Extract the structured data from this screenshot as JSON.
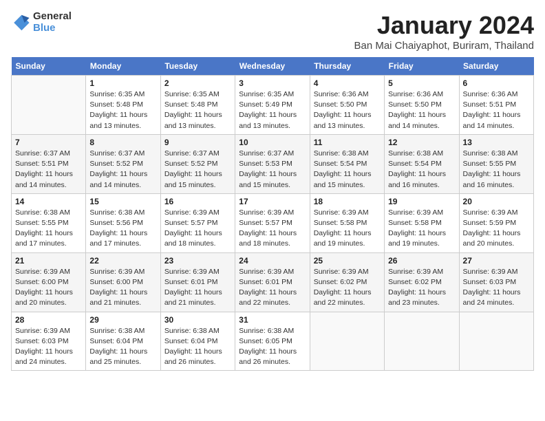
{
  "logo": {
    "general": "General",
    "blue": "Blue"
  },
  "title": {
    "month": "January 2024",
    "location": "Ban Mai Chaiyaphot, Buriram, Thailand"
  },
  "weekdays": [
    "Sunday",
    "Monday",
    "Tuesday",
    "Wednesday",
    "Thursday",
    "Friday",
    "Saturday"
  ],
  "weeks": [
    [
      {
        "day": "",
        "info": ""
      },
      {
        "day": "1",
        "info": "Sunrise: 6:35 AM\nSunset: 5:48 PM\nDaylight: 11 hours\nand 13 minutes."
      },
      {
        "day": "2",
        "info": "Sunrise: 6:35 AM\nSunset: 5:48 PM\nDaylight: 11 hours\nand 13 minutes."
      },
      {
        "day": "3",
        "info": "Sunrise: 6:35 AM\nSunset: 5:49 PM\nDaylight: 11 hours\nand 13 minutes."
      },
      {
        "day": "4",
        "info": "Sunrise: 6:36 AM\nSunset: 5:50 PM\nDaylight: 11 hours\nand 13 minutes."
      },
      {
        "day": "5",
        "info": "Sunrise: 6:36 AM\nSunset: 5:50 PM\nDaylight: 11 hours\nand 14 minutes."
      },
      {
        "day": "6",
        "info": "Sunrise: 6:36 AM\nSunset: 5:51 PM\nDaylight: 11 hours\nand 14 minutes."
      }
    ],
    [
      {
        "day": "7",
        "info": "Sunrise: 6:37 AM\nSunset: 5:51 PM\nDaylight: 11 hours\nand 14 minutes."
      },
      {
        "day": "8",
        "info": "Sunrise: 6:37 AM\nSunset: 5:52 PM\nDaylight: 11 hours\nand 14 minutes."
      },
      {
        "day": "9",
        "info": "Sunrise: 6:37 AM\nSunset: 5:52 PM\nDaylight: 11 hours\nand 15 minutes."
      },
      {
        "day": "10",
        "info": "Sunrise: 6:37 AM\nSunset: 5:53 PM\nDaylight: 11 hours\nand 15 minutes."
      },
      {
        "day": "11",
        "info": "Sunrise: 6:38 AM\nSunset: 5:54 PM\nDaylight: 11 hours\nand 15 minutes."
      },
      {
        "day": "12",
        "info": "Sunrise: 6:38 AM\nSunset: 5:54 PM\nDaylight: 11 hours\nand 16 minutes."
      },
      {
        "day": "13",
        "info": "Sunrise: 6:38 AM\nSunset: 5:55 PM\nDaylight: 11 hours\nand 16 minutes."
      }
    ],
    [
      {
        "day": "14",
        "info": "Sunrise: 6:38 AM\nSunset: 5:55 PM\nDaylight: 11 hours\nand 17 minutes."
      },
      {
        "day": "15",
        "info": "Sunrise: 6:38 AM\nSunset: 5:56 PM\nDaylight: 11 hours\nand 17 minutes."
      },
      {
        "day": "16",
        "info": "Sunrise: 6:39 AM\nSunset: 5:57 PM\nDaylight: 11 hours\nand 18 minutes."
      },
      {
        "day": "17",
        "info": "Sunrise: 6:39 AM\nSunset: 5:57 PM\nDaylight: 11 hours\nand 18 minutes."
      },
      {
        "day": "18",
        "info": "Sunrise: 6:39 AM\nSunset: 5:58 PM\nDaylight: 11 hours\nand 19 minutes."
      },
      {
        "day": "19",
        "info": "Sunrise: 6:39 AM\nSunset: 5:58 PM\nDaylight: 11 hours\nand 19 minutes."
      },
      {
        "day": "20",
        "info": "Sunrise: 6:39 AM\nSunset: 5:59 PM\nDaylight: 11 hours\nand 20 minutes."
      }
    ],
    [
      {
        "day": "21",
        "info": "Sunrise: 6:39 AM\nSunset: 6:00 PM\nDaylight: 11 hours\nand 20 minutes."
      },
      {
        "day": "22",
        "info": "Sunrise: 6:39 AM\nSunset: 6:00 PM\nDaylight: 11 hours\nand 21 minutes."
      },
      {
        "day": "23",
        "info": "Sunrise: 6:39 AM\nSunset: 6:01 PM\nDaylight: 11 hours\nand 21 minutes."
      },
      {
        "day": "24",
        "info": "Sunrise: 6:39 AM\nSunset: 6:01 PM\nDaylight: 11 hours\nand 22 minutes."
      },
      {
        "day": "25",
        "info": "Sunrise: 6:39 AM\nSunset: 6:02 PM\nDaylight: 11 hours\nand 22 minutes."
      },
      {
        "day": "26",
        "info": "Sunrise: 6:39 AM\nSunset: 6:02 PM\nDaylight: 11 hours\nand 23 minutes."
      },
      {
        "day": "27",
        "info": "Sunrise: 6:39 AM\nSunset: 6:03 PM\nDaylight: 11 hours\nand 24 minutes."
      }
    ],
    [
      {
        "day": "28",
        "info": "Sunrise: 6:39 AM\nSunset: 6:03 PM\nDaylight: 11 hours\nand 24 minutes."
      },
      {
        "day": "29",
        "info": "Sunrise: 6:38 AM\nSunset: 6:04 PM\nDaylight: 11 hours\nand 25 minutes."
      },
      {
        "day": "30",
        "info": "Sunrise: 6:38 AM\nSunset: 6:04 PM\nDaylight: 11 hours\nand 26 minutes."
      },
      {
        "day": "31",
        "info": "Sunrise: 6:38 AM\nSunset: 6:05 PM\nDaylight: 11 hours\nand 26 minutes."
      },
      {
        "day": "",
        "info": ""
      },
      {
        "day": "",
        "info": ""
      },
      {
        "day": "",
        "info": ""
      }
    ]
  ]
}
